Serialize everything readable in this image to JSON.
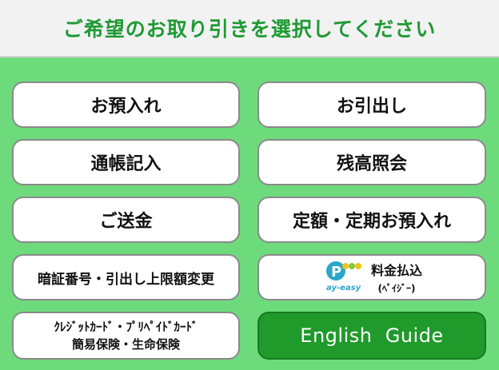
{
  "header": {
    "title": "ご希望のお取り引きを選択してください"
  },
  "buttons": {
    "deposit": "お預入れ",
    "withdrawal": "お引出し",
    "passbook": "通帳記入",
    "balance": "残高照会",
    "transfer": "ご送金",
    "time_deposit": "定額・定期お預入れ",
    "pin_change": "暗証番号・引出し上限額変更",
    "payeasy": {
      "main": "料金払込",
      "sub": "(ﾍﾟｲｼﾞｰ)",
      "logo": "ay-easy"
    },
    "card_insurance": {
      "line1": "ｸﾚｼﾞｯﾄｶｰﾄﾞ・ﾌﾟﾘﾍﾟｲﾄﾞｶｰﾄﾞ",
      "line2": "簡易保険・生命保険"
    },
    "english": "English  Guide"
  },
  "colors": {
    "background": "#6ddb7c",
    "header_text": "#1e9a33",
    "english_button": "#1f9a2b"
  },
  "icons": {
    "payeasy": "pay-easy-logo-icon"
  }
}
